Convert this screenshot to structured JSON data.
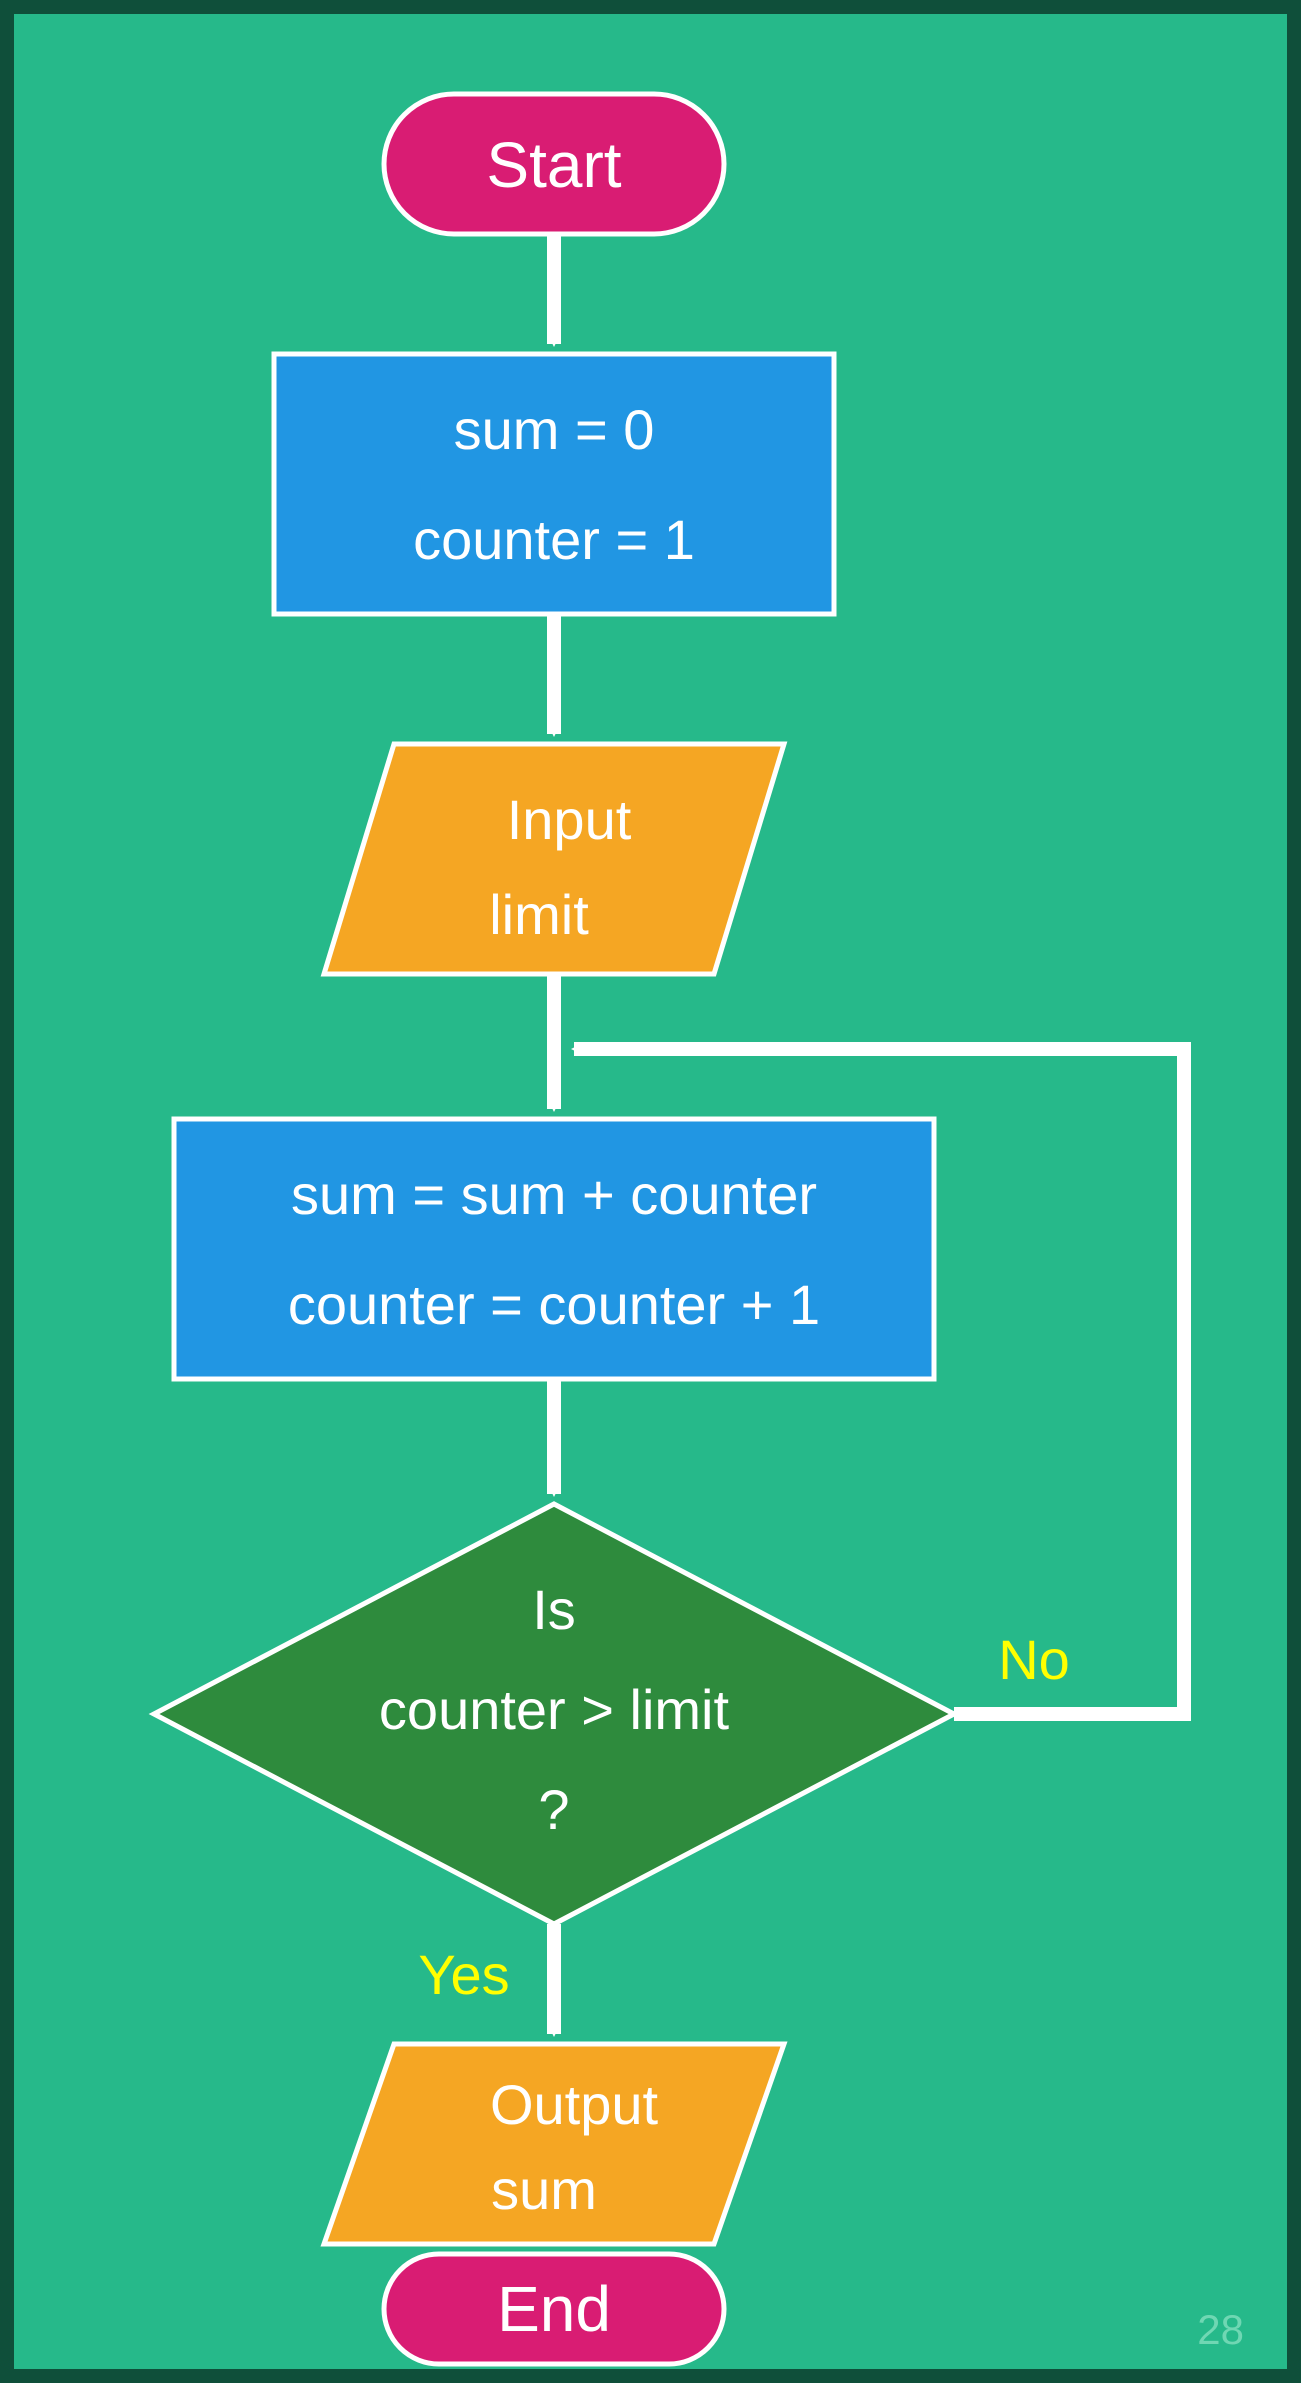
{
  "flowchart": {
    "start": "Start",
    "init_line1": "sum = 0",
    "init_line2": "counter = 1",
    "input_line1": "Input",
    "input_line2": "limit",
    "process_line1": "sum = sum + counter",
    "process_line2": "counter = counter + 1",
    "decision_line1": "Is",
    "decision_line2": "counter > limit",
    "decision_line3": "?",
    "branch_yes": "Yes",
    "branch_no": "No",
    "output_line1": "Output",
    "output_line2": "sum",
    "end": "End"
  },
  "page_number": "28",
  "colors": {
    "bg": "#26b98a",
    "border": "#0f4f3a",
    "terminal": "#d91c73",
    "process": "#2196e3",
    "io": "#f5a623",
    "decision": "#2e8b3d",
    "outline": "#ffffff",
    "arrow": "#ffffff",
    "label": "#ffff00"
  }
}
